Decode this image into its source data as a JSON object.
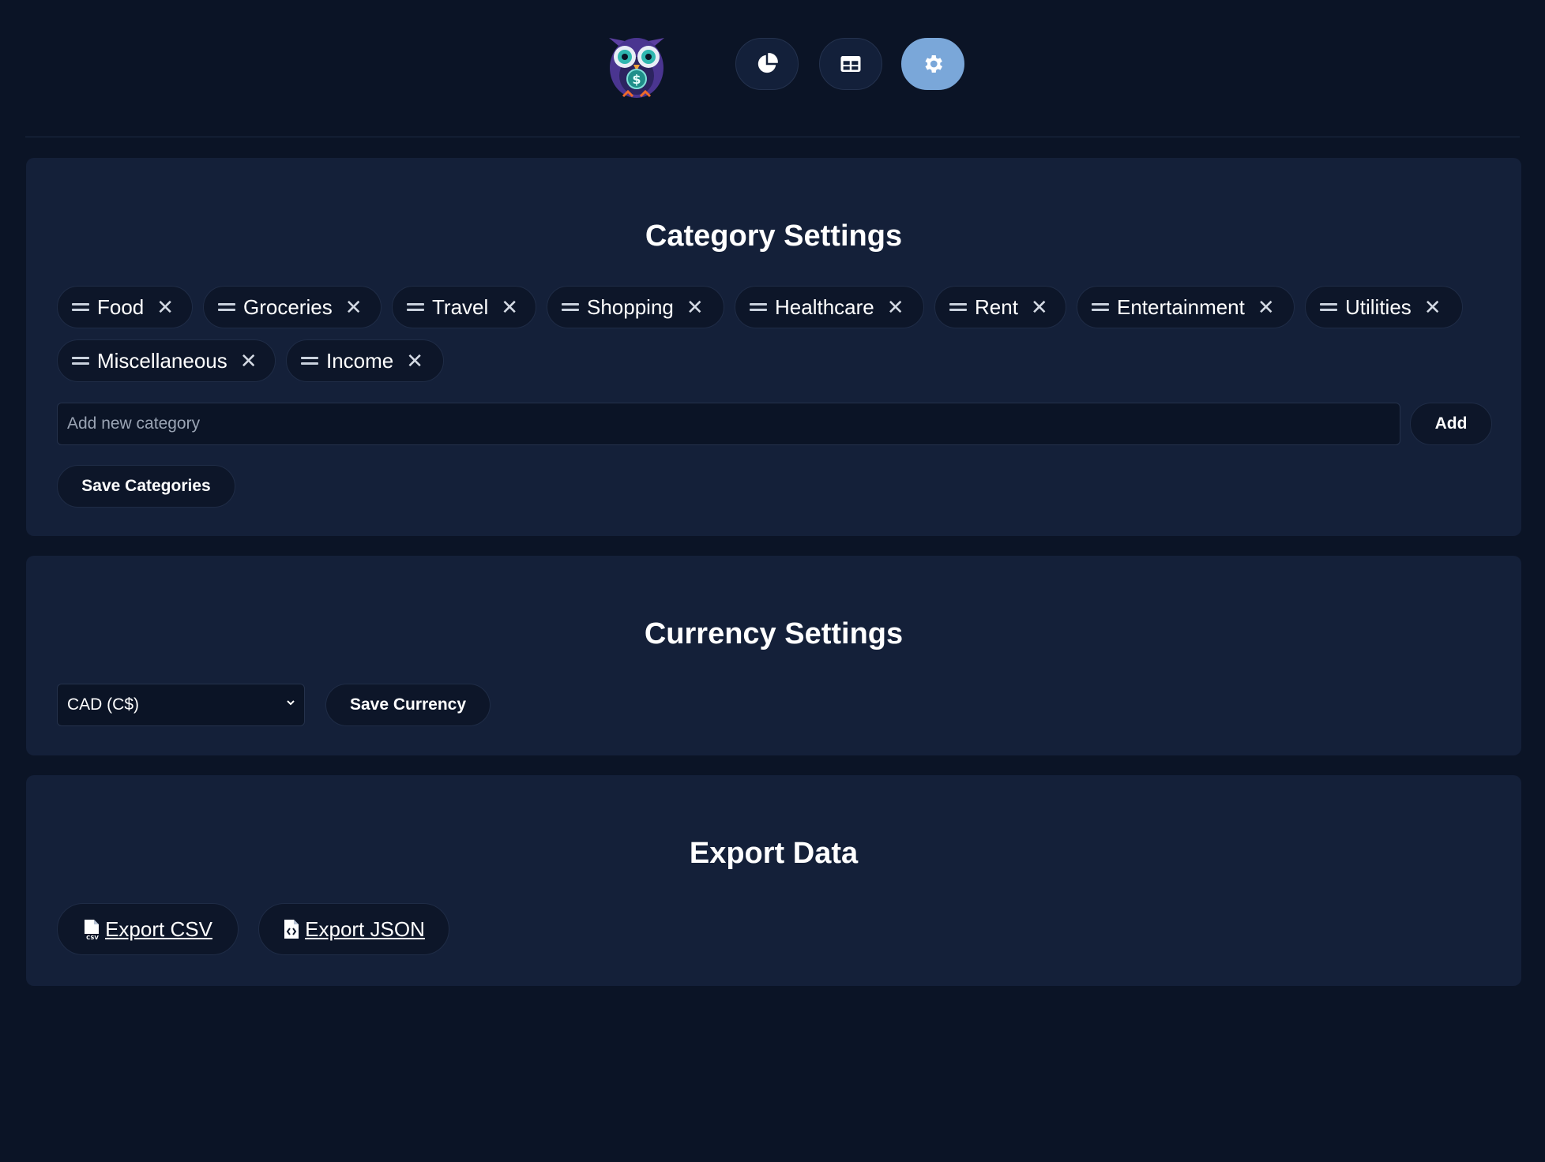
{
  "nav": {
    "items": [
      {
        "icon": "pie-chart-icon",
        "active": false
      },
      {
        "icon": "table-icon",
        "active": false
      },
      {
        "icon": "gear-icon",
        "active": true
      }
    ]
  },
  "category_settings": {
    "title": "Category Settings",
    "categories": [
      "Food",
      "Groceries",
      "Travel",
      "Shopping",
      "Healthcare",
      "Rent",
      "Entertainment",
      "Utilities",
      "Miscellaneous",
      "Income"
    ],
    "remove_symbol": "✕",
    "new_category_placeholder": "Add new category",
    "add_label": "Add",
    "save_label": "Save Categories"
  },
  "currency_settings": {
    "title": "Currency Settings",
    "selected": "CAD (C$)",
    "save_label": "Save Currency"
  },
  "export_data": {
    "title": "Export Data",
    "csv_label": "Export CSV",
    "json_label": "Export JSON"
  },
  "colors": {
    "background": "#0b1426",
    "card": "#142039",
    "active_nav": "#7aa7d9"
  }
}
